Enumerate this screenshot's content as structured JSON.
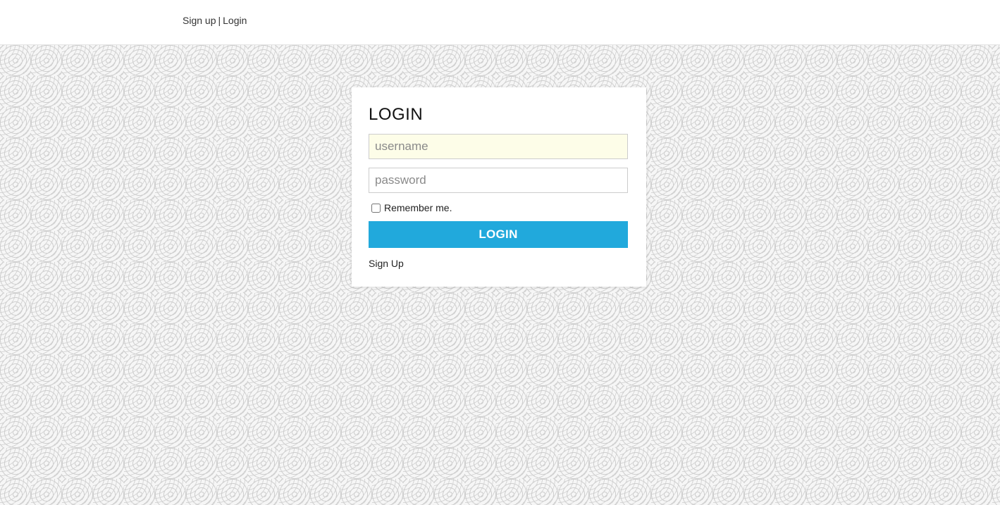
{
  "topnav": {
    "signup_label": "Sign up",
    "separator": "|",
    "login_label": "Login"
  },
  "login_form": {
    "title": "LOGIN",
    "username_placeholder": "username",
    "username_value": "",
    "password_placeholder": "password",
    "password_value": "",
    "remember_label": "Remember me.",
    "remember_checked": false,
    "submit_label": "LOGIN",
    "signup_label": "Sign Up"
  },
  "colors": {
    "accent": "#21a9dc",
    "username_autofill_bg": "#fdfde8",
    "pattern": "#cfcfcf"
  }
}
